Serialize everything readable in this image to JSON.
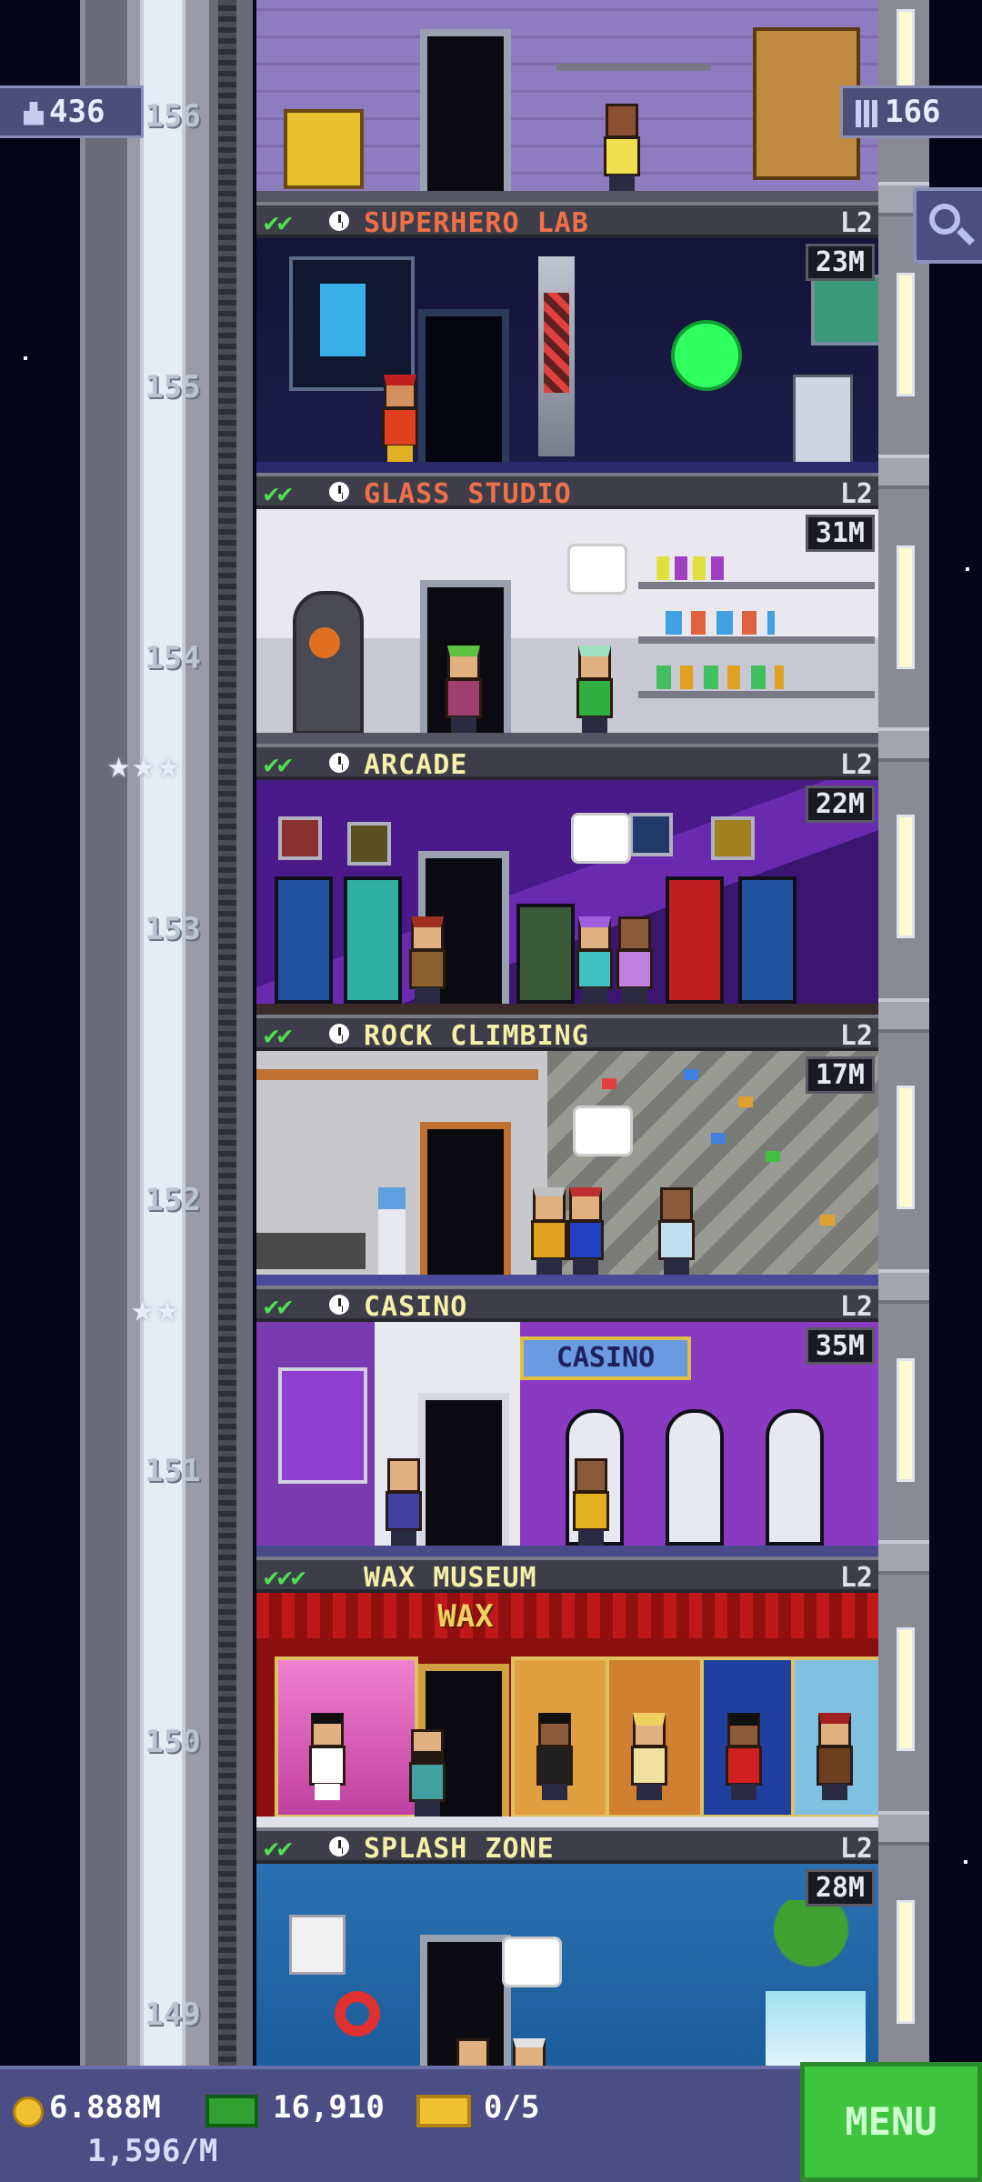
{
  "top_badges": {
    "population": "436",
    "floors_count": "166"
  },
  "elevator_floor_numbers": [
    "156",
    "155",
    "154",
    "153",
    "152",
    "151",
    "150",
    "149"
  ],
  "floor_stars": [
    {
      "floor": "154",
      "stars": "★★★"
    },
    {
      "floor": "152",
      "stars": "★★"
    }
  ],
  "floors": [
    {
      "name": "SUPERHERO LAB",
      "level": "L2",
      "earnings": "23M",
      "name_color": "#f07048"
    },
    {
      "name": "GLASS STUDIO",
      "level": "L2",
      "earnings": "31M",
      "name_color": "#f07048"
    },
    {
      "name": "ARCADE",
      "level": "L2",
      "earnings": "22M",
      "name_color": "#f4f0a8"
    },
    {
      "name": "ROCK CLIMBING",
      "level": "L2",
      "earnings": "17M",
      "name_color": "#f4f0a8"
    },
    {
      "name": "CASINO",
      "level": "L2",
      "earnings": "35M",
      "name_color": "#f4f0a8"
    },
    {
      "name": "WAX MUSEUM",
      "level": "L2",
      "earnings": "",
      "name_color": "#f4f0a8"
    },
    {
      "name": "SPLASH ZONE",
      "level": "L2",
      "earnings": "28M",
      "name_color": "#f4f0a8"
    }
  ],
  "room_signs": {
    "casino_sign": "CASINO",
    "wax_sign": "WAX"
  },
  "bottom_bar": {
    "coins": "6.888M",
    "coins_rate": "1,596/M",
    "bux": "16,910",
    "tickets": "0/5",
    "menu_label": "MENU"
  }
}
